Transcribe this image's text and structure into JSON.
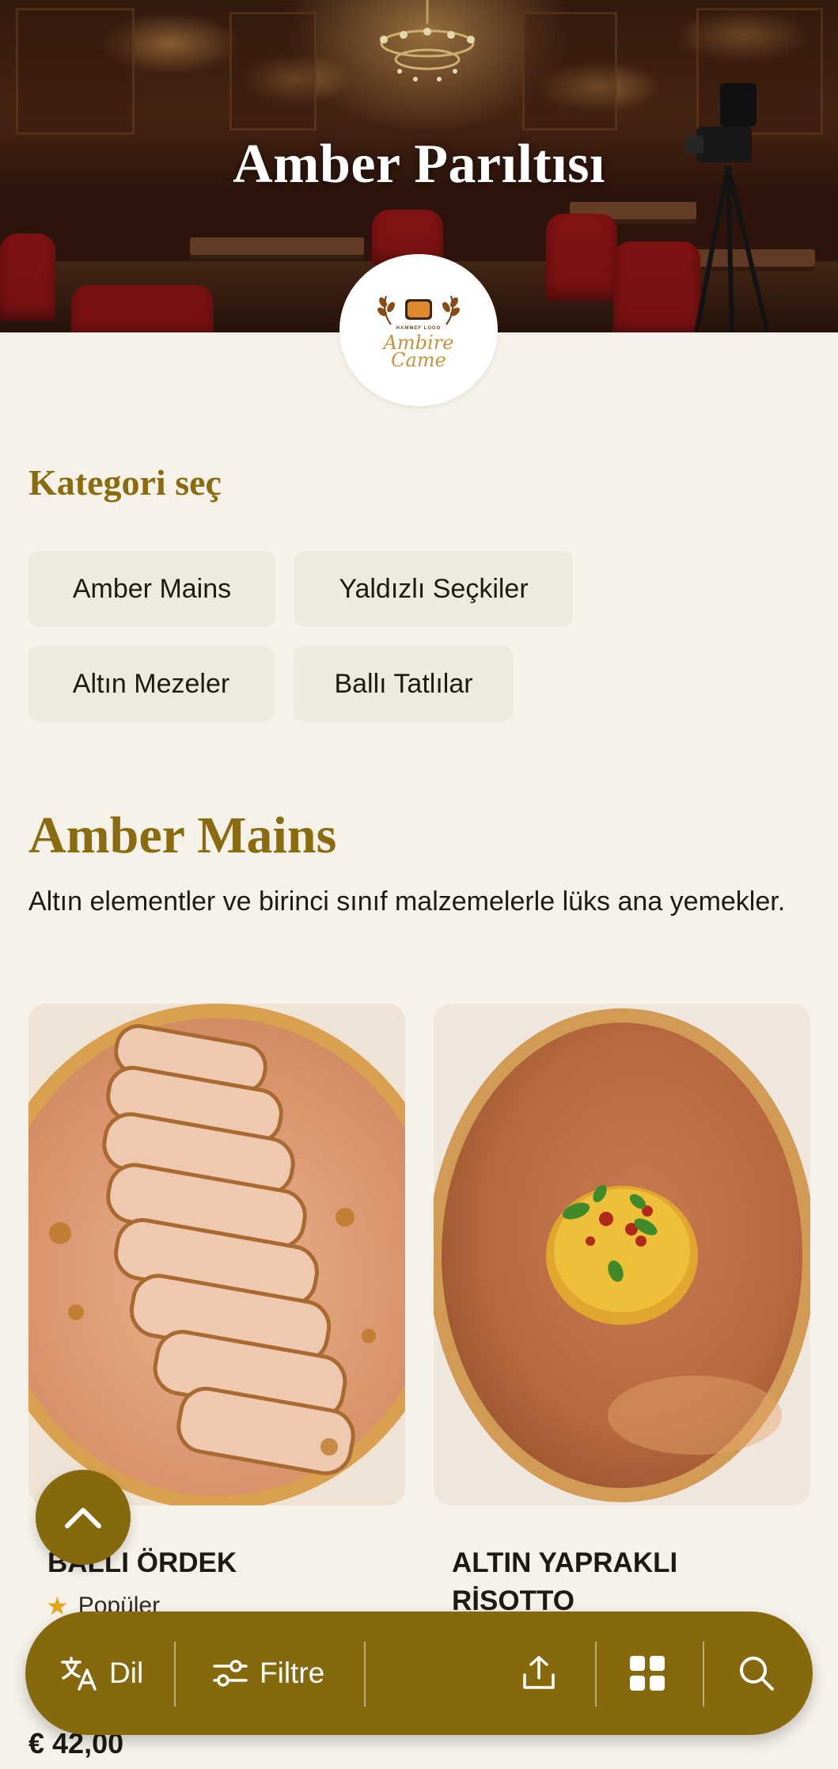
{
  "hero": {
    "title": "Amber Parıltısı"
  },
  "logo": {
    "small_text": "HAMMEF LOGO",
    "name_line1": "Ambire",
    "name_line2": "Came"
  },
  "category": {
    "heading": "Kategori seç",
    "chips": [
      "Amber Mains",
      "Yaldızlı Seçkiler",
      "Altın Mezeler",
      "Ballı Tatlılar"
    ]
  },
  "section": {
    "title": "Amber Mains",
    "description": "Altın elementler ve birinci sınıf malzemelerle lüks ana yemekler."
  },
  "items": [
    {
      "title": "BALLI ÖRDEK",
      "badge": "Popüler",
      "price": "€ 42,00"
    },
    {
      "title_line1": "ALTIN YAPRAKLI",
      "title_line2": "RİSOTTO"
    }
  ],
  "bottom_bar": {
    "language_label": "Dil",
    "filter_label": "Filtre"
  },
  "colors": {
    "accent": "#85690c",
    "heading": "#8a6b0e",
    "background": "#f6f2ea",
    "chip": "#eeeadd",
    "star": "#e8a41a"
  },
  "icons": [
    "translate-icon",
    "filter-icon",
    "share-icon",
    "grid-icon",
    "search-icon",
    "chevron-up-icon",
    "star-icon"
  ]
}
